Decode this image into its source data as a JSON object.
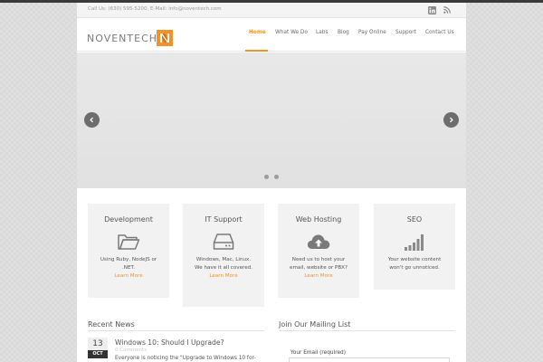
{
  "topbar": {
    "contact": "Call Us: (630) 595-5200, E-Mail: info@noventech.com",
    "social": [
      {
        "icon": "linkedin-icon"
      },
      {
        "icon": "rss-icon"
      }
    ]
  },
  "header": {
    "logo_text": "NOVENTECH",
    "logo_letter": "N"
  },
  "nav": {
    "items": [
      "Home",
      "What We Do",
      "Labs",
      "Blog",
      "Pay Online",
      "Support",
      "Contact Us"
    ],
    "active": "Home"
  },
  "slider": {
    "prev_icon": "chevron-left-icon",
    "next_icon": "chevron-right-icon",
    "dots": 2
  },
  "services": [
    {
      "title": "Development",
      "icon": "folder-icon",
      "description": "Using Ruby, NodeJS or .NET.",
      "link": "Learn More"
    },
    {
      "title": "IT Support",
      "icon": "hard-drive-icon",
      "description": "Windows, Mac, Linux. We have it all covered.",
      "link": "Learn More"
    },
    {
      "title": "Web Hosting",
      "icon": "cloud-upload-icon",
      "description": "Need us to host your email, website or PBX?",
      "link": "Learn More"
    },
    {
      "title": "SEO",
      "icon": "signal-bars-icon",
      "description": "Your website content won't go unnoticed.",
      "link": ""
    }
  ],
  "news": {
    "title": "Recent News",
    "post": {
      "day": "13",
      "month": "OCT",
      "title": "Windows 10: Should I Upgrade?",
      "comments": "0 Comments",
      "excerpt": "Everyone is noticing the \"Upgrade to Windows 10 for-"
    }
  },
  "mailing": {
    "title": "Join Our Mailing List",
    "email_label": "Your Email (required)",
    "email_value": ""
  },
  "colors": {
    "accent": "#f2922a",
    "text": "#555555",
    "panel": "#f2f2f2"
  }
}
